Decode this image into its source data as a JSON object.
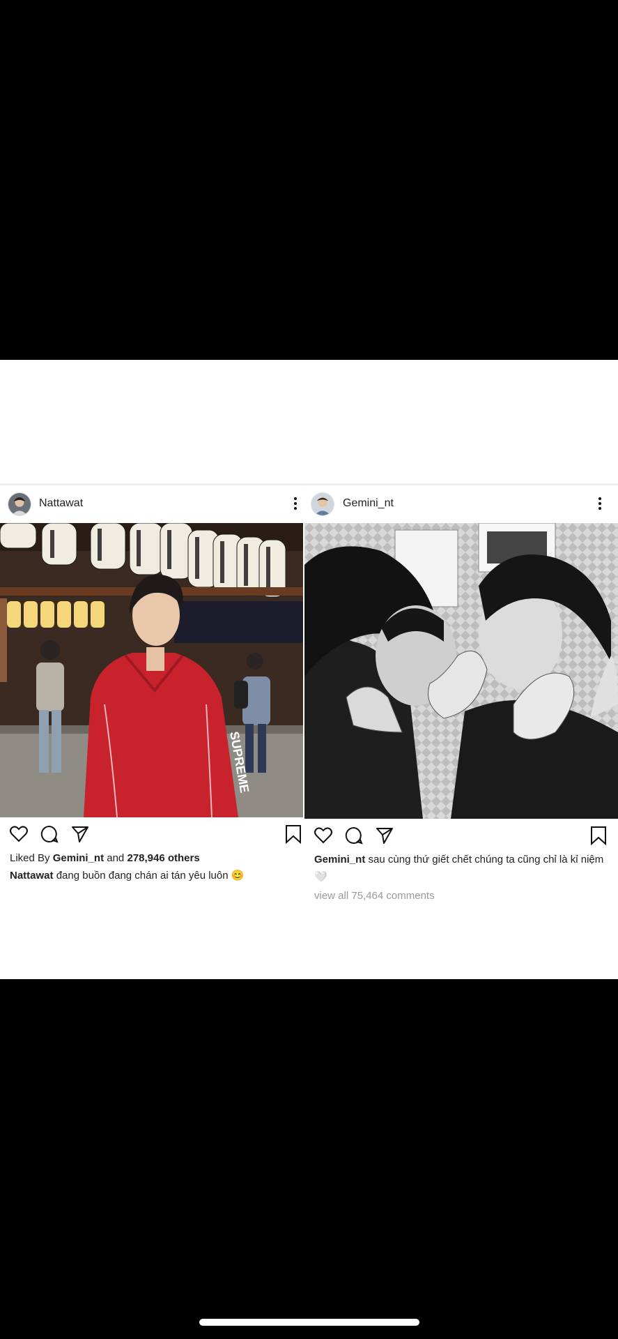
{
  "left_post": {
    "username": "Nattawat",
    "likes_prefix": "Liked By",
    "likes_user": "Gemini_nt",
    "likes_and": "and",
    "likes_count": "278,946 others",
    "caption_user": "Nattawat",
    "caption_text": "đang buồn đang chán ai tán yêu luôn 😊"
  },
  "right_post": {
    "username": "Gemini_nt",
    "caption_user": "Gemini_nt",
    "caption_text": "sau cùng thứ giết chết chúng ta cũng chỉ là kỉ niệm🤍",
    "comments_link": "view all 75,464 comments"
  },
  "icons": {
    "like": "heart-icon",
    "comment": "comment-icon",
    "share": "paper-plane-icon",
    "save": "bookmark-icon",
    "more": "more-vertical-icon"
  },
  "colors": {
    "background": "#000000",
    "card": "#ffffff",
    "jacket_red": "#c8232c",
    "text": "#222222",
    "muted": "#999999"
  }
}
